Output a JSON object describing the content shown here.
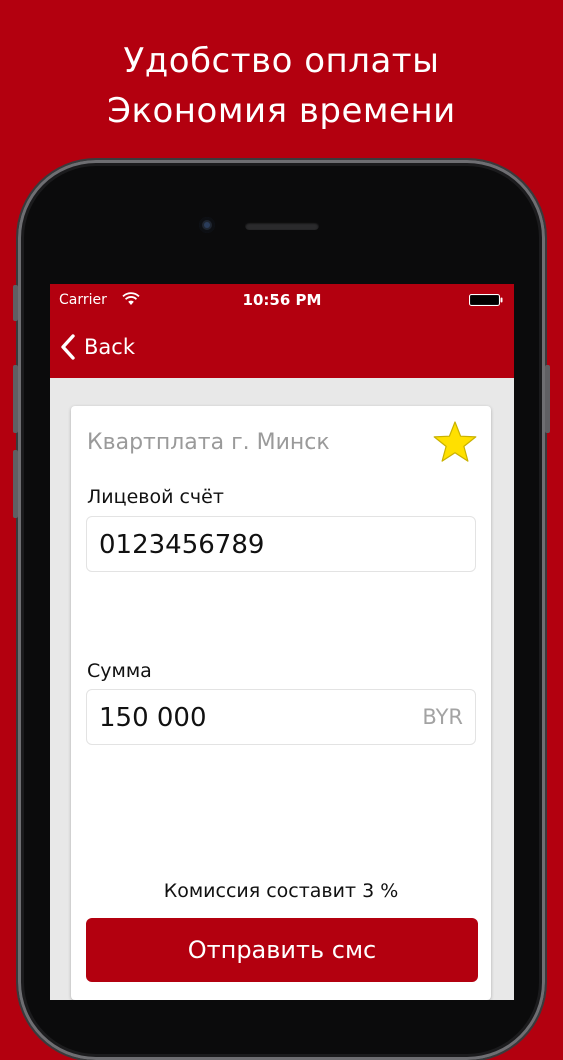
{
  "headline": {
    "line1": "Удобство оплаты",
    "line2": "Экономия времени"
  },
  "status_bar": {
    "carrier": "Carrier",
    "time": "10:56 PM",
    "icons": [
      "wifi-icon",
      "battery-icon"
    ]
  },
  "nav": {
    "back_label": "Back",
    "back_icon": "chevron-left-icon"
  },
  "form": {
    "provider_title": "Квартплата г. Минск",
    "favorite_icon": "star-icon",
    "account_label": "Лицевой счёт",
    "account_value": "0123456789",
    "amount_label": "Сумма",
    "amount_value": "150 000",
    "currency": "BYR",
    "commission_text": "Комиссия составит 3 %",
    "submit_label": "Отправить смс"
  },
  "colors": {
    "brand_red": "#b3000f",
    "star_yellow": "#ffe000",
    "card_bg": "#ffffff",
    "screen_bg": "#e8e8e8"
  }
}
